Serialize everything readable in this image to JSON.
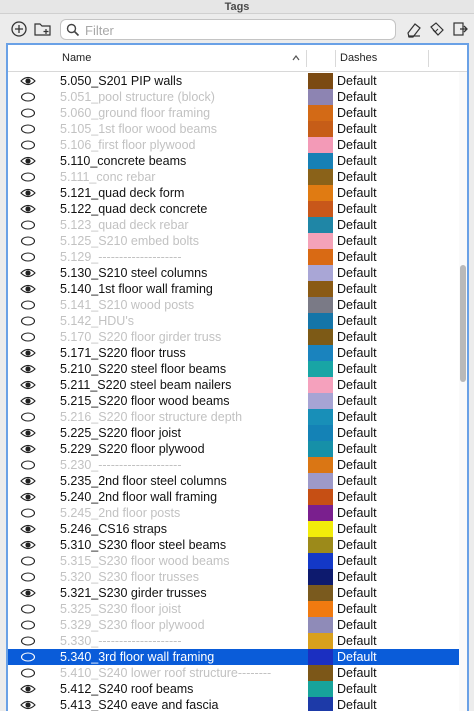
{
  "window": {
    "title": "Tags"
  },
  "toolbar": {
    "left_icons": [
      "add-circle-icon",
      "new-folder-icon"
    ],
    "right_icons": [
      "eraser-icon",
      "tags-icon",
      "export-icon"
    ],
    "search": {
      "placeholder": "Filter",
      "value": ""
    }
  },
  "table": {
    "columns": [
      "Name",
      "Dashes"
    ],
    "sort": {
      "column": "Name",
      "direction": "ascending"
    },
    "rows": [
      {
        "name": "5.050_S201 PIP walls",
        "visible": true,
        "color": "#7b4a12",
        "dashes": "Default",
        "selected": false
      },
      {
        "name": "5.051_pool structure (block)",
        "visible": false,
        "color": "#8d84b2",
        "dashes": "Default",
        "selected": false
      },
      {
        "name": "5.060_ground floor framing",
        "visible": false,
        "color": "#d36a16",
        "dashes": "Default",
        "selected": false
      },
      {
        "name": "5.105_1st floor wood beams",
        "visible": false,
        "color": "#c65d18",
        "dashes": "Default",
        "selected": false
      },
      {
        "name": "5.106_first floor plywood",
        "visible": false,
        "color": "#f39ab7",
        "dashes": "Default",
        "selected": false
      },
      {
        "name": "5.110_concrete beams",
        "visible": true,
        "color": "#1780b5",
        "dashes": "Default",
        "selected": false
      },
      {
        "name": "5.111_conc rebar",
        "visible": false,
        "color": "#8a6219",
        "dashes": "Default",
        "selected": false
      },
      {
        "name": "5.121_quad deck form",
        "visible": true,
        "color": "#e07b12",
        "dashes": "Default",
        "selected": false
      },
      {
        "name": "5.122_quad deck concrete",
        "visible": true,
        "color": "#c8571a",
        "dashes": "Default",
        "selected": false
      },
      {
        "name": "5.123_quad deck rebar",
        "visible": false,
        "color": "#1f86a6",
        "dashes": "Default",
        "selected": false
      },
      {
        "name": "5.125_S210 embed bolts",
        "visible": false,
        "color": "#f4a2b8",
        "dashes": "Default",
        "selected": false
      },
      {
        "name": "5.129_--------------------",
        "visible": false,
        "color": "#d96a14",
        "dashes": "Default",
        "selected": false
      },
      {
        "name": "5.130_S210 steel columns",
        "visible": true,
        "color": "#a9a6d6",
        "dashes": "Default",
        "selected": false
      },
      {
        "name": "5.140_1st floor wall framing",
        "visible": true,
        "color": "#8a5a14",
        "dashes": "Default",
        "selected": false
      },
      {
        "name": "5.141_S210 wood posts",
        "visible": false,
        "color": "#7a7a86",
        "dashes": "Default",
        "selected": false
      },
      {
        "name": "5.142_HDU's",
        "visible": false,
        "color": "#1575a8",
        "dashes": "Default",
        "selected": false
      },
      {
        "name": "5.170_S220 floor girder truss",
        "visible": false,
        "color": "#7d5a16",
        "dashes": "Default",
        "selected": false
      },
      {
        "name": "5.171_S220 floor truss",
        "visible": true,
        "color": "#1a83be",
        "dashes": "Default",
        "selected": false
      },
      {
        "name": "5.210_S220 steel floor beams",
        "visible": true,
        "color": "#18a5a5",
        "dashes": "Default",
        "selected": false
      },
      {
        "name": "5.211_S220 steel beam nailers",
        "visible": true,
        "color": "#f5a1bd",
        "dashes": "Default",
        "selected": false
      },
      {
        "name": "5.215_S220 floor wood beams",
        "visible": true,
        "color": "#a7a4d4",
        "dashes": "Default",
        "selected": false
      },
      {
        "name": "5.216_S220 floor structure depth",
        "visible": false,
        "color": "#188fb8",
        "dashes": "Default",
        "selected": false
      },
      {
        "name": "5.225_S220 floor joist",
        "visible": true,
        "color": "#1482b6",
        "dashes": "Default",
        "selected": false
      },
      {
        "name": "5.229_S220 floor plywood",
        "visible": true,
        "color": "#1690a8",
        "dashes": "Default",
        "selected": false
      },
      {
        "name": "5.230_--------------------",
        "visible": false,
        "color": "#da7614",
        "dashes": "Default",
        "selected": false
      },
      {
        "name": "5.235_2nd floor steel columns",
        "visible": true,
        "color": "#9d99c9",
        "dashes": "Default",
        "selected": false
      },
      {
        "name": "5.240_2nd floor wall framing",
        "visible": true,
        "color": "#c64f14",
        "dashes": "Default",
        "selected": false
      },
      {
        "name": "5.245_2nd floor posts",
        "visible": false,
        "color": "#7a1f8e",
        "dashes": "Default",
        "selected": false
      },
      {
        "name": "5.246_CS16 straps",
        "visible": true,
        "color": "#f2ec0a",
        "dashes": "Default",
        "selected": false
      },
      {
        "name": "5.310_S230 floor steel beams",
        "visible": true,
        "color": "#9c8a1a",
        "dashes": "Default",
        "selected": false
      },
      {
        "name": "5.315_S230 floor wood beams",
        "visible": false,
        "color": "#1338c7",
        "dashes": "Default",
        "selected": false
      },
      {
        "name": "5.320_S230 floor trusses",
        "visible": false,
        "color": "#0d1a6e",
        "dashes": "Default",
        "selected": false
      },
      {
        "name": "5.321_S230 girder trusses",
        "visible": true,
        "color": "#7a5a1e",
        "dashes": "Default",
        "selected": false
      },
      {
        "name": "5.325_S230 floor joist",
        "visible": false,
        "color": "#f07a10",
        "dashes": "Default",
        "selected": false
      },
      {
        "name": "5.329_S230 floor plywood",
        "visible": false,
        "color": "#8f8bb8",
        "dashes": "Default",
        "selected": false
      },
      {
        "name": "5.330_--------------------",
        "visible": false,
        "color": "#d9a01c",
        "dashes": "Default",
        "selected": false
      },
      {
        "name": "5.340_3rd floor wall framing",
        "visible": false,
        "color": "#1b2fc1",
        "dashes": "Default",
        "selected": true
      },
      {
        "name": "5.410_S240 lower roof structure--------",
        "visible": false,
        "color": "#7c5718",
        "dashes": "Default",
        "selected": false
      },
      {
        "name": "5.412_S240 roof beams",
        "visible": true,
        "color": "#17a39b",
        "dashes": "Default",
        "selected": false
      },
      {
        "name": "5.413_S240 eave and fascia",
        "visible": true,
        "color": "#1d3aa8",
        "dashes": "Default",
        "selected": false
      }
    ]
  }
}
